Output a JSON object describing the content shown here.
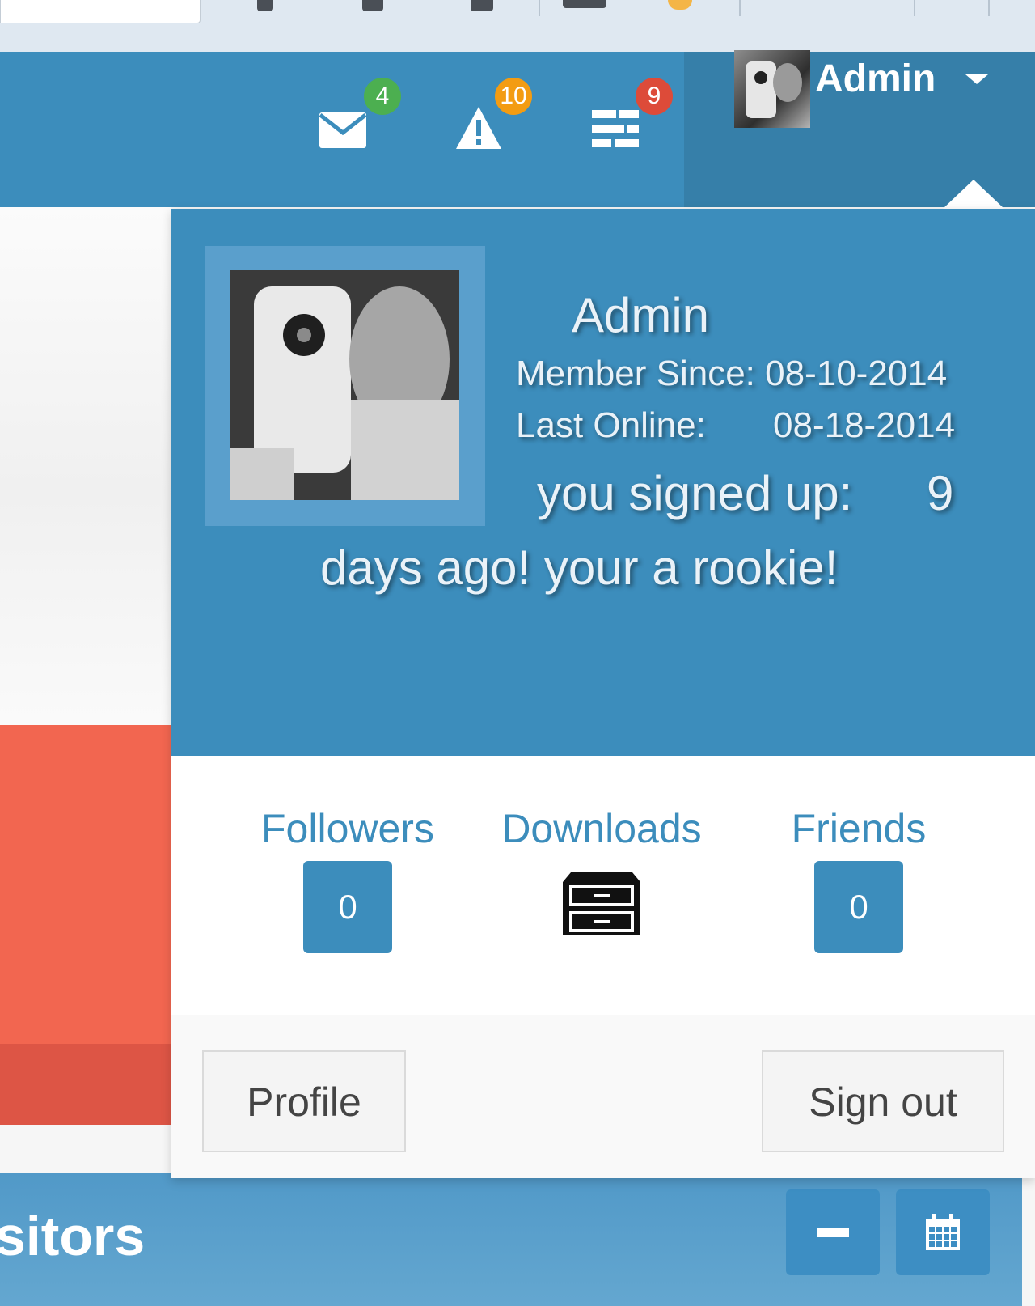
{
  "navbar": {
    "messages": {
      "icon": "envelope-icon",
      "count": "4"
    },
    "notifications": {
      "icon": "warning-icon",
      "count": "10"
    },
    "tasks": {
      "icon": "tasks-icon",
      "count": "9"
    },
    "user": {
      "name": "Admin",
      "avatar": "user-avatar"
    }
  },
  "dropdown": {
    "header": {
      "name": "Admin",
      "member_since_label": "Member Since:",
      "member_since": "08-10-2014",
      "last_online_label": "Last Online:",
      "last_online": "08-18-2014",
      "signed_up_label": "you signed up:",
      "signed_up_days": "9",
      "signed_up_tail": "days ago! your a rookie!"
    },
    "stats": {
      "followers": {
        "label": "Followers",
        "value": "0"
      },
      "downloads": {
        "label": "Downloads",
        "icon": "file-cabinet-icon"
      },
      "friends": {
        "label": "Friends",
        "value": "0"
      }
    },
    "footer": {
      "profile": "Profile",
      "signout": "Sign out"
    }
  },
  "background": {
    "box_title": "sitors"
  },
  "colors": {
    "primary": "#3c8dbc",
    "primary_dark": "#367fa9",
    "badge_green": "#4caf50",
    "badge_orange": "#f39c12",
    "badge_red": "#dd4b39",
    "red_box": "#f26650"
  }
}
